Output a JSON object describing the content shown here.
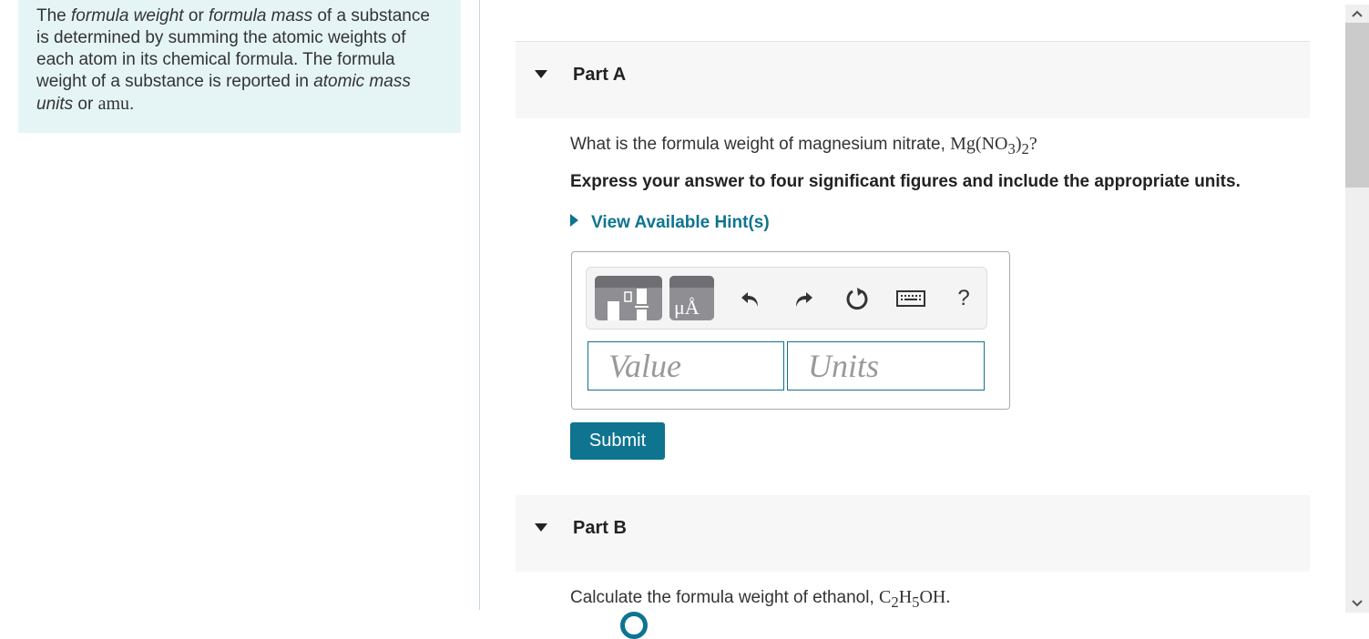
{
  "intro": {
    "t1": "The ",
    "t2": "formula weight",
    "t3": " or ",
    "t4": "formula mass",
    "t5": " of a substance is determined by summing the atomic weights of each atom in its chemical formula. The formula weight of a substance is reported in ",
    "t6": "atomic mass units",
    "t7": " or ",
    "t8": "amu",
    "t9": "."
  },
  "partA": {
    "title": "Part A",
    "question_prefix": "What is the formula weight of magnesium nitrate, ",
    "formula": {
      "a": "Mg(NO",
      "sub1": "3",
      "b": ")",
      "sub2": "2",
      "c": "?"
    },
    "instruction": "Express your answer to four significant figures and include the appropriate units.",
    "hint_label": "View Available Hint(s)",
    "toolbar": {
      "templates_icon": "fraction-template-icon",
      "units_icon": "units-angstrom-icon",
      "units_label": "μÅ",
      "undo_icon": "undo-icon",
      "redo_icon": "redo-icon",
      "reset_icon": "reset-icon",
      "keyboard_icon": "keyboard-icon",
      "help_label": "?"
    },
    "value_placeholder": "Value",
    "units_placeholder": "Units",
    "value": "",
    "units": "",
    "submit_label": "Submit"
  },
  "partB": {
    "title": "Part B",
    "question_prefix": "Calculate the formula weight of ethanol, ",
    "formula": {
      "a": "C",
      "sub1": "2",
      "b": "H",
      "sub2": "5",
      "c": "OH",
      "d": "."
    }
  },
  "colors": {
    "accent": "#0e7490",
    "intro_bg": "#e5f5f6",
    "part_header_bg": "#f7f7f7"
  }
}
